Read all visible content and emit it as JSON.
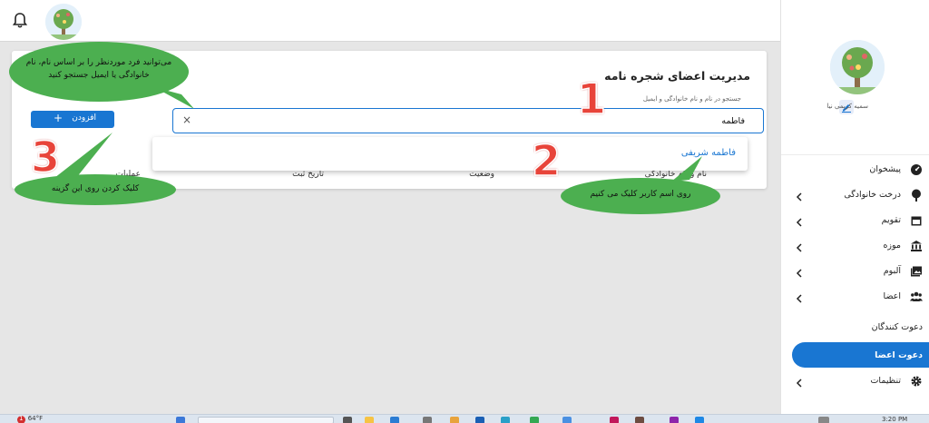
{
  "sidebar": {
    "user_name": "سمیه کریمی نیا",
    "items": [
      {
        "label": "پیشخوان",
        "icon": "dashboard-icon",
        "chevron": false
      },
      {
        "label": "درخت خانوادگی",
        "icon": "tree-icon",
        "chevron": true
      },
      {
        "label": "تقویم",
        "icon": "calendar-icon",
        "chevron": true
      },
      {
        "label": "موزه",
        "icon": "museum-icon",
        "chevron": true
      },
      {
        "label": "آلبوم",
        "icon": "album-icon",
        "chevron": true
      },
      {
        "label": "اعضا",
        "icon": "members-icon",
        "chevron": true
      },
      {
        "label": "دعوت کنندگان",
        "icon": "",
        "chevron": false
      },
      {
        "label": "دعوت اعضا",
        "icon": "",
        "chevron": false,
        "active": true
      },
      {
        "label": "تنظیمات",
        "icon": "gear-icon",
        "chevron": true
      }
    ]
  },
  "page": {
    "title": "مدیریت اعضای شجره نامه",
    "search": {
      "label": "جستجو در نام و نام خانوادگی و ایمیل",
      "value": "فاطمه",
      "clear_symbol": "×"
    },
    "add_button": {
      "label": "افزودن",
      "icon": "+"
    },
    "columns": [
      "نام و نام خانوادگی",
      "وضعیت",
      "تاریخ ثبت",
      "عملیات"
    ],
    "autocomplete": [
      "فاطمه شریفی"
    ]
  },
  "annotations": {
    "bubble_search": "می‌توانید فرد موردنظر را بر اساس نام، نام خانوادگی یا ایمیل جستجو کنید",
    "bubble_select": "روی اسم کاربر کلیک می کنیم",
    "bubble_add": "کلیک کردن روی این گزینه",
    "step1": "1",
    "step2": "2",
    "step3": "3"
  },
  "taskbar": {
    "weather": "64°F",
    "weather_badge": "1",
    "clock": "3:20 PM"
  },
  "colors": {
    "accent": "#1976d2",
    "callout": "#4caf50",
    "step_number": "#e8443a"
  }
}
